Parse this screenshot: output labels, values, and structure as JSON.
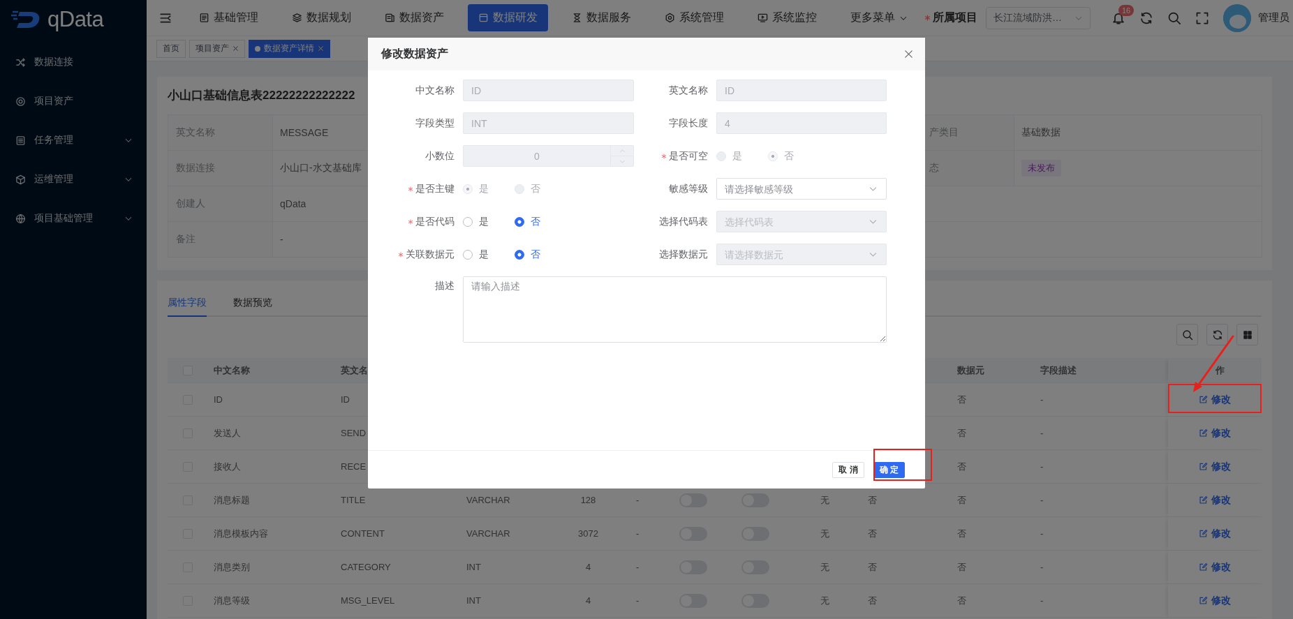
{
  "sidebar": {
    "logo": "qData",
    "items": [
      {
        "label": "数据连接",
        "has_children": false
      },
      {
        "label": "项目资产",
        "has_children": false
      },
      {
        "label": "任务管理",
        "has_children": true
      },
      {
        "label": "运维管理",
        "has_children": true
      },
      {
        "label": "项目基础管理",
        "has_children": true
      }
    ]
  },
  "header": {
    "nav": [
      {
        "label": "基础管理",
        "selected": false
      },
      {
        "label": "数据规划",
        "selected": false
      },
      {
        "label": "数据资产",
        "selected": false
      },
      {
        "label": "数据研发",
        "selected": true
      },
      {
        "label": "数据服务",
        "selected": false
      },
      {
        "label": "系统管理",
        "selected": false
      },
      {
        "label": "系统监控",
        "selected": false
      }
    ],
    "more_menu": "更多菜单",
    "project_label": "所属项目",
    "project_required": true,
    "project_value": "长江流域防洪…",
    "notification_count": "16",
    "user": "管理员"
  },
  "tabs_bar": [
    {
      "label": "首页",
      "selected": false,
      "closable": false
    },
    {
      "label": "项目资产",
      "selected": false,
      "closable": true
    },
    {
      "label": "数据资产详情",
      "selected": true,
      "closable": true
    }
  ],
  "detail": {
    "title": "小山口基础信息表22222222222222",
    "rows": [
      {
        "label": "英文名称",
        "value": "MESSAGE",
        "right_label": "产类目",
        "right_value": "基础数据"
      },
      {
        "label": "数据连接",
        "value": "小山口-水文基础库",
        "right_label": "态",
        "right_tag": "未发布"
      },
      {
        "label": "创建人",
        "value": "qData"
      },
      {
        "label": "备注",
        "value": "-"
      }
    ]
  },
  "field_tabs": [
    {
      "label": "属性字段",
      "selected": true
    },
    {
      "label": "数据预览",
      "selected": false
    }
  ],
  "table": {
    "header": {
      "checked": false,
      "name": "中文名称",
      "en": "英文名",
      "data_element": "数据元",
      "description": "字段描述",
      "action": "作"
    },
    "rows": [
      {
        "checked": false,
        "name": "ID",
        "en": "ID",
        "data_element": "否",
        "description": "-",
        "action": "修改"
      },
      {
        "checked": false,
        "name": "发送人",
        "en": "SEND",
        "data_element": "否",
        "description": "-",
        "action": "修改"
      },
      {
        "checked": false,
        "name": "接收人",
        "en": "RECE",
        "data_element": "否",
        "description": "-",
        "action": "修改"
      },
      {
        "checked": false,
        "name": "消息标题",
        "en": "TITLE",
        "type": "VARCHAR",
        "length": "128",
        "column_5": "-",
        "column_6": {
          "on": false
        },
        "column_7": {
          "on": false
        },
        "column_8": "无",
        "column_9": "否",
        "data_element": "否",
        "description": "-",
        "action": "修改"
      },
      {
        "checked": false,
        "name": "消息模板内容",
        "en": "CONTENT",
        "type": "VARCHAR",
        "length": "3072",
        "column_5": "-",
        "column_6": {
          "on": false
        },
        "column_7": {
          "on": false
        },
        "column_8": "无",
        "column_9": "否",
        "data_element": "否",
        "description": "-",
        "action": "修改"
      },
      {
        "checked": false,
        "name": "消息类别",
        "en": "CATEGORY",
        "type": "INT",
        "length": "4",
        "column_5": "-",
        "column_6": {
          "on": false
        },
        "column_7": {
          "on": false
        },
        "column_8": "无",
        "column_9": "否",
        "data_element": "否",
        "description": "-",
        "action": "修改"
      },
      {
        "checked": false,
        "name": "消息等级",
        "en": "MSG_LEVEL",
        "type": "INT",
        "length": "4",
        "column_5": "-",
        "column_6": {
          "on": false
        },
        "column_7": {
          "on": false
        },
        "column_8": "无",
        "column_9": "否",
        "data_element": "否",
        "description": "-",
        "action": "修改"
      }
    ]
  },
  "modal": {
    "title": "修改数据资产",
    "fields": [
      {
        "kind": "input",
        "label": "中文名称",
        "required": false,
        "disabled": true,
        "value": "ID"
      },
      {
        "kind": "input",
        "label": "英文名称",
        "required": false,
        "disabled": true,
        "value": "ID"
      },
      {
        "kind": "input",
        "label": "字段类型",
        "required": false,
        "disabled": true,
        "value": "INT"
      },
      {
        "kind": "input",
        "label": "字段长度",
        "required": false,
        "disabled": true,
        "value": "4"
      },
      {
        "kind": "number",
        "label": "小数位",
        "required": false,
        "disabled": true,
        "value": "0"
      },
      {
        "kind": "radio",
        "label": "是否可空",
        "required": true,
        "disabled": true,
        "options": [
          {
            "label": "是",
            "selected": false
          },
          {
            "label": "否",
            "selected": true
          }
        ]
      },
      {
        "kind": "radio",
        "label": "是否主键",
        "required": true,
        "disabled": true,
        "options": [
          {
            "label": "是",
            "selected": true
          },
          {
            "label": "否",
            "selected": false
          }
        ]
      },
      {
        "kind": "select",
        "label": "敏感等级",
        "required": false,
        "disabled": false,
        "placeholder": "请选择敏感等级"
      },
      {
        "kind": "radio",
        "label": "是否代码",
        "required": true,
        "disabled": false,
        "options": [
          {
            "label": "是",
            "selected": false
          },
          {
            "label": "否",
            "selected": true
          }
        ]
      },
      {
        "kind": "select",
        "label": "选择代码表",
        "required": false,
        "disabled": true,
        "placeholder": "选择代码表"
      },
      {
        "kind": "radio",
        "label": "关联数据元",
        "required": true,
        "disabled": false,
        "options": [
          {
            "label": "是",
            "selected": false
          },
          {
            "label": "否",
            "selected": true
          }
        ]
      },
      {
        "kind": "select",
        "label": "选择数据元",
        "required": false,
        "disabled": true,
        "placeholder": "请选择数据元"
      },
      {
        "kind": "textarea",
        "label": "描述",
        "required": false,
        "disabled": false,
        "placeholder": "请输入描述"
      }
    ],
    "buttons": [
      {
        "label": "取 消",
        "kind": "default"
      },
      {
        "label": "确 定",
        "kind": "primary"
      }
    ]
  }
}
